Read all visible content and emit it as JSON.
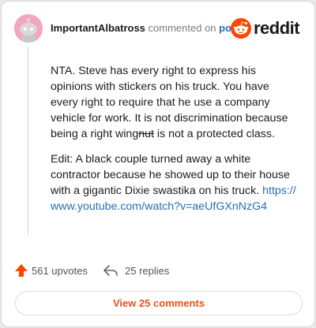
{
  "comment": {
    "username": "ImportantAlbatross",
    "verb": "commented on",
    "post_link": "post",
    "brand": "reddit",
    "paragraph1_before_strike": "NTA. Steve has every right to express his opinions with stickers on his truck. You have every right to require that he use a company vehicle for work. It is not discrimination because being a right wing",
    "paragraph1_strike": "nut",
    "paragraph1_after_strike": " is not a protected class.",
    "paragraph2_text": "Edit: A black couple turned away a white contractor because he showed up to their house with a gigantic Dixie swastika on his truck. ",
    "paragraph2_link": "https://www.youtube.com/watch?v=aeUfGXnNzG4"
  },
  "actions": {
    "upvotes": "561 upvotes",
    "replies": "25 replies",
    "view_comments": "View 25 comments"
  },
  "colors": {
    "upvote": "#ff4500",
    "brand": "#ff4500",
    "link": "#2a6db0",
    "view_button_text": "#e8521a"
  }
}
